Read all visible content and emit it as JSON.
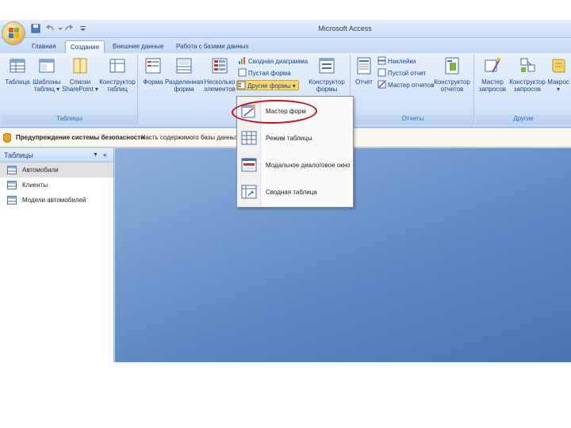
{
  "app_title": "Microsoft Access",
  "tabs": [
    "Главная",
    "Создание",
    "Внешние данные",
    "Работа с базами данных"
  ],
  "ribbon": {
    "tables_group": {
      "label": "Таблицы",
      "buttons": [
        {
          "l1": "Таблица",
          "l2": ""
        },
        {
          "l1": "Шаблоны",
          "l2": "таблиц ▾"
        },
        {
          "l1": "Списки",
          "l2": "SharePoint ▾"
        },
        {
          "l1": "Конструктор",
          "l2": "таблиц"
        }
      ]
    },
    "forms_group": {
      "buttons": [
        {
          "l1": "Форма",
          "l2": ""
        },
        {
          "l1": "Разделенная",
          "l2": "форма"
        },
        {
          "l1": "Несколько",
          "l2": "элементов"
        }
      ],
      "pivot_chart": "Сводная диаграмма",
      "blank_form": "Пустая форма",
      "other_forms": "Другие формы ▾",
      "form_designer": {
        "l1": "Конструктор",
        "l2": "формы"
      }
    },
    "reports_group": {
      "label": "Отчеты",
      "report": "Отчет",
      "labels": "Наклейки",
      "blank_report": "Пустой отчет",
      "report_wizard": "Мастер отчетов",
      "report_designer": {
        "l1": "Конструктор",
        "l2": "отчетов"
      }
    },
    "other_group": {
      "label": "Другие",
      "buttons": [
        {
          "l1": "Мастер",
          "l2": "запросов"
        },
        {
          "l1": "Конструктор",
          "l2": "запросов"
        },
        {
          "l1": "Макрос",
          "l2": "▾"
        }
      ]
    }
  },
  "security_bar": {
    "title": "Предупреждение системы безопасности",
    "text": "Часть содержимого базы данных"
  },
  "nav_pane": {
    "title": "Таблицы",
    "items": [
      "Автомобили",
      "Клиенты",
      "Модели автомобилей"
    ]
  },
  "dropdown_menu": {
    "items": [
      "Мастер форм",
      "Режим таблицы",
      "Модальное диалоговое окно",
      "Сводная таблица"
    ]
  },
  "colors": {
    "accent": "#15428b",
    "highlight": "#c0151d",
    "workspace": "#6a93cc"
  }
}
